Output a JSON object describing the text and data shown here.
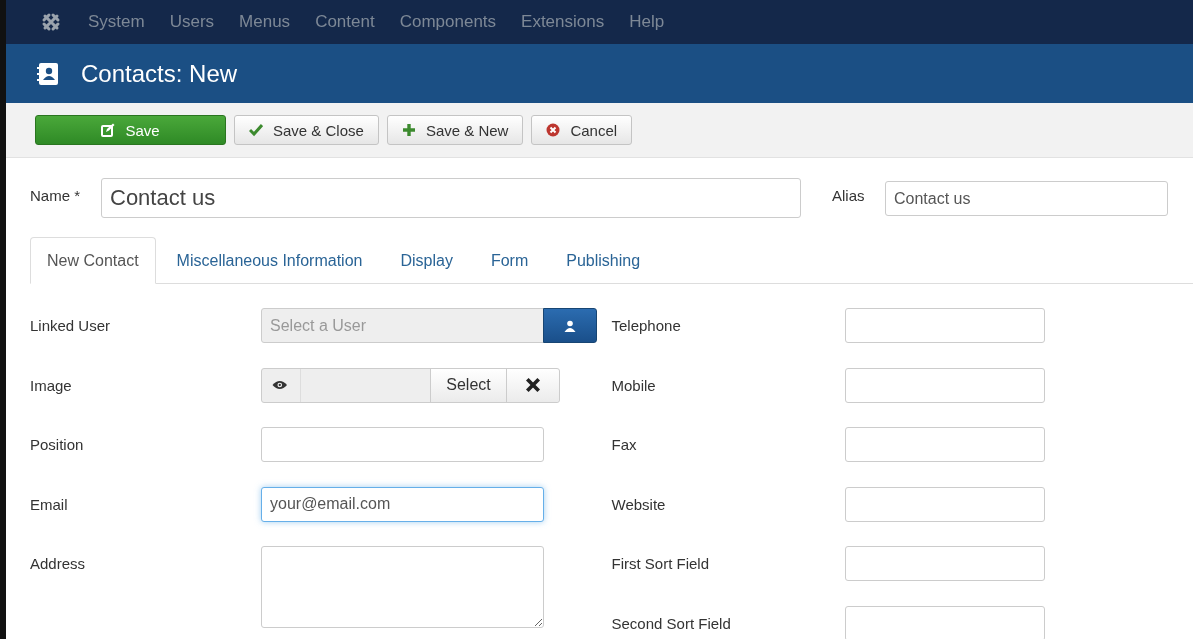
{
  "menu": [
    {
      "label": "System"
    },
    {
      "label": "Users"
    },
    {
      "label": "Menus"
    },
    {
      "label": "Content"
    },
    {
      "label": "Components"
    },
    {
      "label": "Extensions"
    },
    {
      "label": "Help"
    }
  ],
  "page_title": "Contacts: New",
  "toolbar": [
    {
      "kind": "save",
      "label": "Save"
    },
    {
      "kind": "save-close",
      "label": "Save & Close"
    },
    {
      "kind": "save-new",
      "label": "Save & New"
    },
    {
      "kind": "cancel",
      "label": "Cancel"
    }
  ],
  "name": {
    "label": "Name *",
    "value": "Contact us"
  },
  "alias": {
    "label": "Alias",
    "value": "Contact us"
  },
  "tabs": [
    {
      "label": "New Contact",
      "selected": true
    },
    {
      "label": "Miscellaneous Information",
      "selected": false
    },
    {
      "label": "Display",
      "selected": false
    },
    {
      "label": "Form",
      "selected": false
    },
    {
      "label": "Publishing",
      "selected": false
    }
  ],
  "left_fields": [
    {
      "kind": "user",
      "label": "Linked User",
      "placeholder": "Select a User"
    },
    {
      "kind": "media",
      "label": "Image",
      "button": "Select"
    },
    {
      "kind": "text",
      "label": "Position",
      "focused": false
    },
    {
      "kind": "text",
      "label": "Email",
      "value": "your@email.com",
      "focused": true
    },
    {
      "kind": "textarea",
      "label": "Address"
    }
  ],
  "right_fields": [
    {
      "label": "Telephone"
    },
    {
      "label": "Mobile"
    },
    {
      "label": "Fax"
    },
    {
      "label": "Website"
    },
    {
      "label": "First Sort Field"
    },
    {
      "label": "Second Sort Field"
    }
  ]
}
